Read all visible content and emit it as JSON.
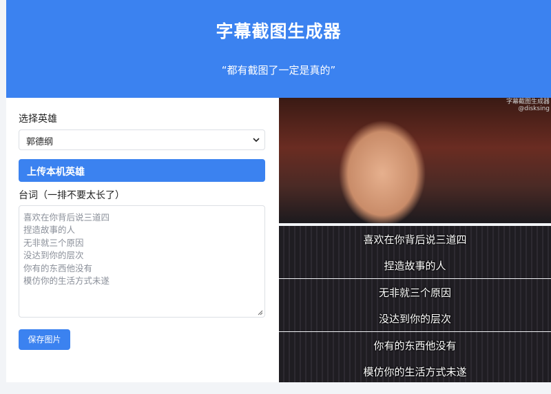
{
  "header": {
    "title": "字幕截图生成器",
    "subtitle": "“都有截图了一定是真的”"
  },
  "form": {
    "hero_label": "选择英雄",
    "hero_selected": "郭德纲",
    "upload_label": "上传本机英雄",
    "lines_label": "台词（一排不要太长了）",
    "lines": [
      "喜欢在你背后说三道四",
      "捏造故事的人",
      "无非就三个原因",
      "没达到你的层次",
      "你有的东西他没有",
      "模仿你的生活方式未遂"
    ],
    "save_label": "保存图片"
  },
  "preview": {
    "watermark_line1": "字幕截图生成器",
    "watermark_line2": "@disksing",
    "subtitles": [
      "喜欢在你背后说三道四",
      "捏造故事的人",
      "无非就三个原因",
      "没达到你的层次",
      "你有的东西他没有",
      "模仿你的生活方式未遂"
    ]
  },
  "icons": {
    "select_chevron": "chevron-down-icon",
    "resize_grip": "resize-grip-icon"
  },
  "colors": {
    "accent": "#3b82f0"
  }
}
